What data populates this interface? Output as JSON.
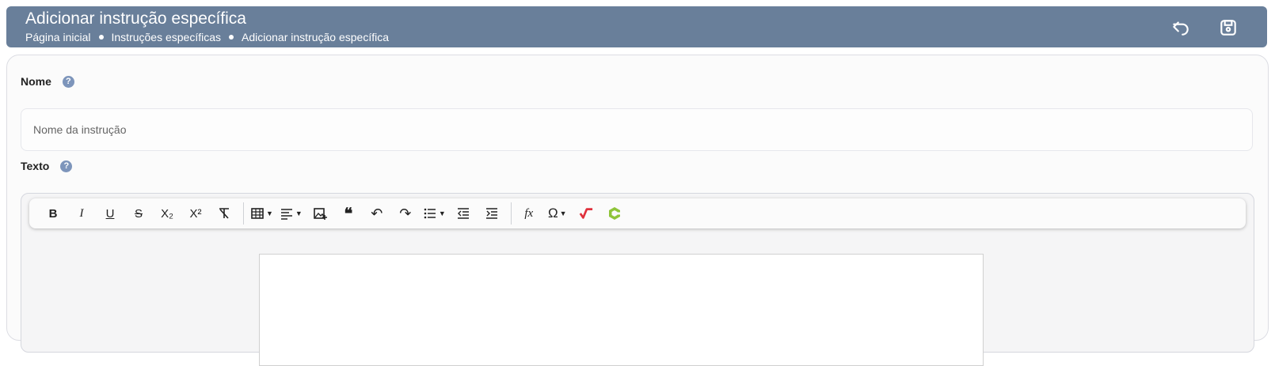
{
  "header": {
    "title": "Adicionar instrução específica",
    "breadcrumb": [
      "Página inicial",
      "Instruções específicas",
      "Adicionar instrução específica"
    ],
    "back_icon": "undo-arrow-icon",
    "save_icon": "save-icon",
    "background": "#697f9a"
  },
  "form": {
    "name_label": "Nome",
    "name_help": "?",
    "name_placeholder": "Nome da instrução",
    "name_value": "",
    "text_label": "Texto",
    "text_help": "?"
  },
  "editor": {
    "toolbar": [
      {
        "name": "bold-button",
        "glyph": "B"
      },
      {
        "name": "italic-button",
        "glyph": "I"
      },
      {
        "name": "underline-button",
        "glyph": "U"
      },
      {
        "name": "strikethrough-button",
        "glyph": "S"
      },
      {
        "name": "subscript-button",
        "glyph": "X₂"
      },
      {
        "name": "superscript-button",
        "glyph": "X²"
      },
      {
        "name": "remove-format-button",
        "glyph": "T̸"
      },
      {
        "name": "table-button",
        "glyph": "▦"
      },
      {
        "name": "align-button",
        "glyph": "≡"
      },
      {
        "name": "insert-image-button",
        "glyph": "🖼"
      },
      {
        "name": "blockquote-button",
        "glyph": "❝"
      },
      {
        "name": "undo-button",
        "glyph": "↶"
      },
      {
        "name": "redo-button",
        "glyph": "↷"
      },
      {
        "name": "bulleted-list-button",
        "glyph": "☰"
      },
      {
        "name": "outdent-button",
        "glyph": "⇤"
      },
      {
        "name": "indent-button",
        "glyph": "⇥"
      },
      {
        "name": "math-formula-button",
        "glyph": "fx"
      },
      {
        "name": "special-characters-button",
        "glyph": "Ω"
      },
      {
        "name": "wiris-math-button",
        "glyph": "√"
      },
      {
        "name": "chemistry-button",
        "glyph": "C"
      }
    ],
    "accent_red": "#e0313c",
    "accent_green": "#8fc43a"
  }
}
